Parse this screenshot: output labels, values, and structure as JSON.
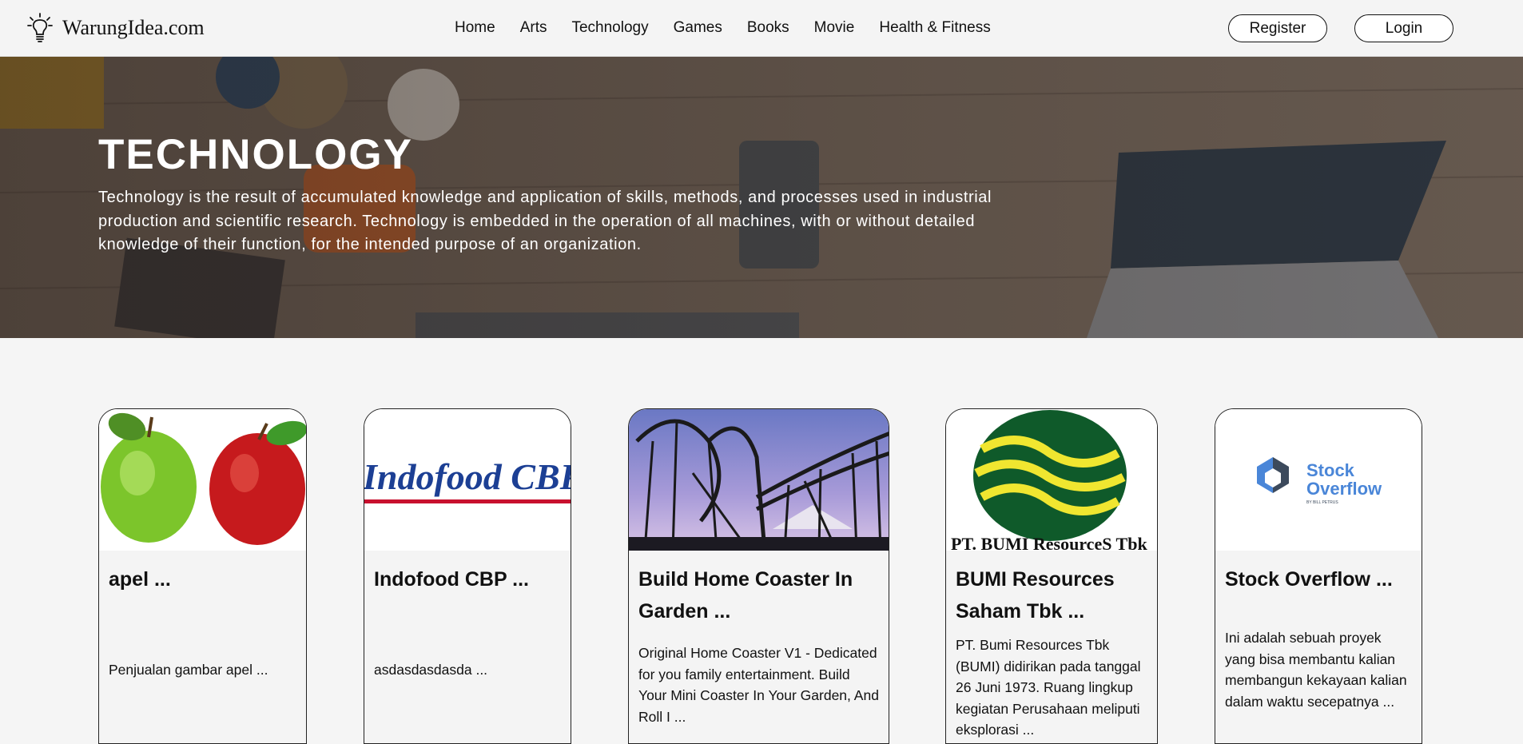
{
  "brand": {
    "name": "WarungIdea.com",
    "icon": "lightbulb-icon"
  },
  "nav": {
    "links": [
      "Home",
      "Arts",
      "Technology",
      "Games",
      "Books",
      "Movie",
      "Health & Fitness"
    ],
    "register_label": "Register",
    "login_label": "Login"
  },
  "hero": {
    "title": "TECHNOLOGY",
    "description": "Technology is the result of accumulated knowledge and application of skills, methods, and processes used in industrial production and scientific research. Technology is embedded in the operation of all machines, with or without detailed knowledge of their function, for the intended purpose of an organization."
  },
  "cards": [
    {
      "title": "apel ...",
      "description": "Penjualan gambar apel ...",
      "image": "apples-image"
    },
    {
      "title": "Indofood CBP ...",
      "description": "asdasdasdasda ...",
      "image": "indofood-logo",
      "logo_text": "Indofood CBP"
    },
    {
      "title": "Build Home Coaster In Garden ...",
      "description": "Original Home Coaster V1 - Dedicated for you family entertainment. Build Your Mini Coaster In Your Garden, And Roll I ...",
      "image": "roller-coaster-image"
    },
    {
      "title": "BUMI Resources Saham Tbk ...",
      "description": "PT. Bumi Resources Tbk (BUMI) didirikan pada tanggal 26 Juni 1973. Ruang lingkup kegiatan Perusahaan meliputi eksplorasi ...",
      "image": "bumi-logo",
      "logo_text": "PT. BUMI ResourceS Tbk"
    },
    {
      "title": "Stock Overflow ...",
      "description": "Ini adalah sebuah proyek yang bisa membantu kalian membangun kekayaan kalian dalam waktu secepatnya ...",
      "image": "stock-overflow-logo",
      "logo_text_line1": "Stock",
      "logo_text_line2": "Overflow",
      "logo_subtext": "BY BILL PETRUS"
    }
  ]
}
